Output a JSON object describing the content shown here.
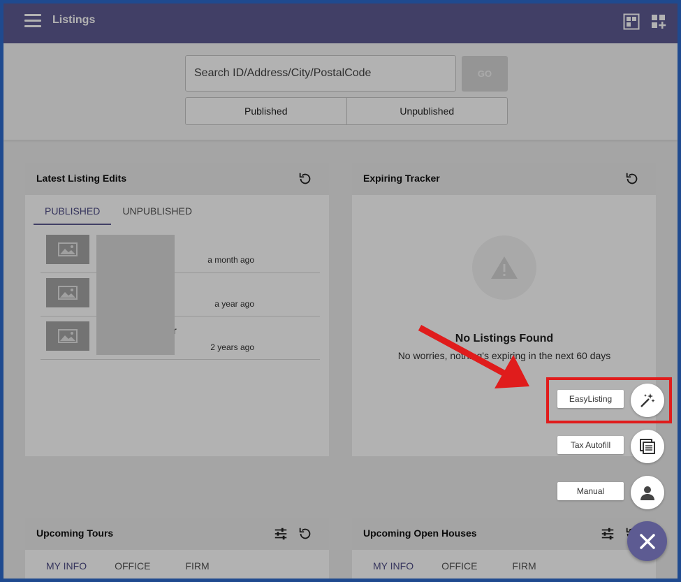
{
  "header": {
    "title": "Listings",
    "color": "#5d5b92"
  },
  "search": {
    "placeholder": "Search ID/Address/City/PostalCode",
    "go_label": "GO",
    "segments": [
      "Published",
      "Unpublished"
    ]
  },
  "latest_edits": {
    "title": "Latest Listing Edits",
    "tabs": [
      "PUBLISHED",
      "UNPUBLISHED"
    ],
    "rows": [
      {
        "address": "",
        "time": "a month ago"
      },
      {
        "address": "",
        "time": "a year ago"
      },
      {
        "address": "Dr",
        "time": "2 years ago"
      }
    ]
  },
  "expiring": {
    "title": "Expiring Tracker",
    "empty_title": "No Listings Found",
    "empty_sub": "No worries, nothing's expiring in the next 60 days"
  },
  "tours": {
    "title": "Upcoming Tours",
    "tabs": [
      "MY INFO",
      "OFFICE",
      "FIRM"
    ]
  },
  "open_houses": {
    "title": "Upcoming Open Houses",
    "tabs": [
      "MY INFO",
      "OFFICE",
      "FIRM"
    ]
  },
  "fab_menu": {
    "items": [
      {
        "label": "EasyListing",
        "icon": "magic-wand-icon"
      },
      {
        "label": "Tax Autofill",
        "icon": "documents-icon"
      },
      {
        "label": "Manual",
        "icon": "person-icon"
      }
    ],
    "close_icon": "close-icon",
    "highlight_color": "#e01c1c"
  }
}
